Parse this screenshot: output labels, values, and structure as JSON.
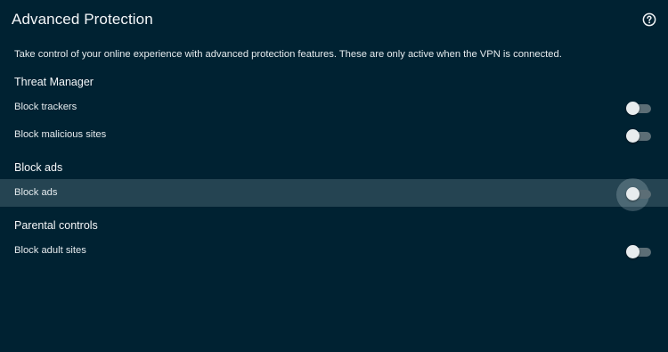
{
  "header": {
    "title": "Advanced Protection",
    "help_icon": "question-circle-icon"
  },
  "description": "Take control of your online experience with advanced protection features. These are only active when the VPN is connected.",
  "sections": [
    {
      "title": "Threat Manager",
      "items": [
        {
          "label": "Block trackers",
          "enabled": false
        },
        {
          "label": "Block malicious sites",
          "enabled": false
        }
      ]
    },
    {
      "title": "Block ads",
      "items": [
        {
          "label": "Block ads",
          "enabled": false,
          "focused": true
        }
      ]
    },
    {
      "title": "Parental controls",
      "items": [
        {
          "label": "Block adult sites",
          "enabled": false
        }
      ]
    }
  ],
  "colors": {
    "background": "#002232",
    "focused_row": "#254452",
    "toggle_track_off": "#5c6e76",
    "toggle_thumb": "#e8ecee"
  }
}
